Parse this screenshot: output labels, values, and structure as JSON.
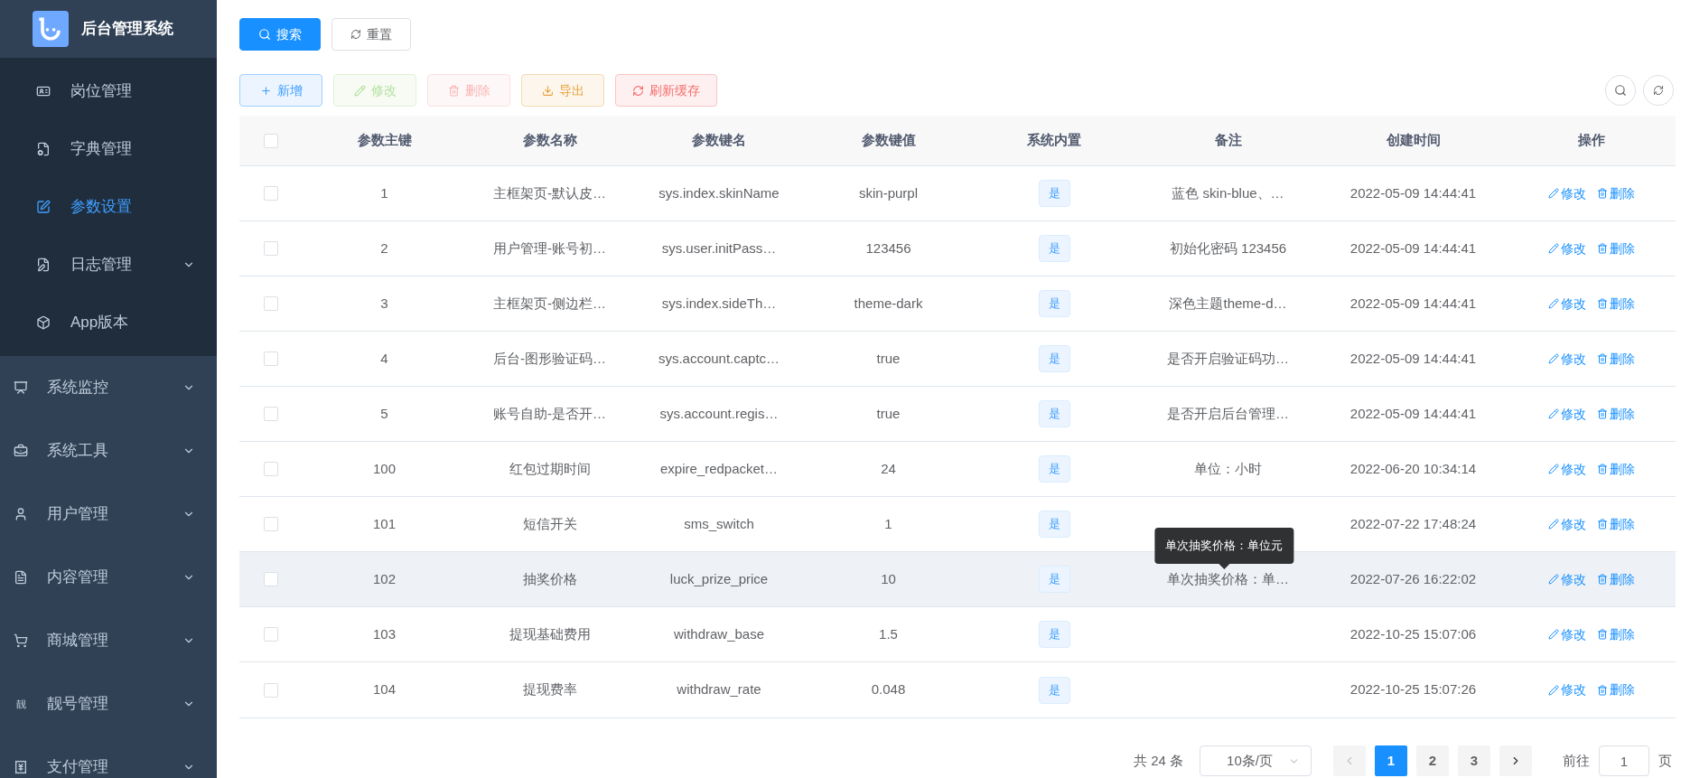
{
  "sidebar": {
    "title": "后台管理系统",
    "submenu_items": [
      {
        "label": "岗位管理",
        "kind": "link",
        "selected": false
      },
      {
        "label": "字典管理",
        "kind": "link",
        "selected": false
      },
      {
        "label": "参数设置",
        "kind": "link",
        "selected": true
      },
      {
        "label": "日志管理",
        "kind": "group",
        "selected": false
      },
      {
        "label": "App版本",
        "kind": "link",
        "selected": false
      }
    ],
    "items": [
      {
        "label": "系统监控"
      },
      {
        "label": "系统工具"
      },
      {
        "label": "用户管理"
      },
      {
        "label": "内容管理"
      },
      {
        "label": "商城管理"
      },
      {
        "label": "靓号管理",
        "icon_text": "靓"
      },
      {
        "label": "支付管理"
      }
    ]
  },
  "search_buttons": [
    {
      "label": "搜索",
      "kind": "primary"
    },
    {
      "label": "重置",
      "kind": "default"
    }
  ],
  "toolbar": [
    {
      "label": "新增",
      "kind": "add",
      "disabled": false
    },
    {
      "label": "修改",
      "kind": "edit",
      "disabled": true
    },
    {
      "label": "删除",
      "kind": "delete",
      "disabled": true
    },
    {
      "label": "导出",
      "kind": "export",
      "disabled": false
    },
    {
      "label": "刷新缓存",
      "kind": "refresh",
      "disabled": false
    }
  ],
  "table": {
    "columns": [
      "参数主键",
      "参数名称",
      "参数键名",
      "参数键值",
      "系统内置",
      "备注",
      "创建时间",
      "操作"
    ],
    "rows": [
      {
        "id": "1",
        "name": "主框架页-默认皮…",
        "key": "sys.index.skinName",
        "value": "skin-purpl",
        "builtin": "是",
        "remark": "蓝色 skin-blue、…",
        "created": "2022-05-09 14:44:41",
        "hovered": false,
        "checked": false,
        "actions": [
          "修改",
          "删除"
        ]
      },
      {
        "id": "2",
        "name": "用户管理-账号初…",
        "key": "sys.user.initPass…",
        "value": "123456",
        "builtin": "是",
        "remark": "初始化密码 123456",
        "created": "2022-05-09 14:44:41",
        "hovered": false,
        "checked": false,
        "actions": [
          "修改",
          "删除"
        ]
      },
      {
        "id": "3",
        "name": "主框架页-侧边栏…",
        "key": "sys.index.sideTh…",
        "value": "theme-dark",
        "builtin": "是",
        "remark": "深色主题theme-d…",
        "created": "2022-05-09 14:44:41",
        "hovered": false,
        "checked": false,
        "actions": [
          "修改",
          "删除"
        ]
      },
      {
        "id": "4",
        "name": "后台-图形验证码…",
        "key": "sys.account.captc…",
        "value": "true",
        "builtin": "是",
        "remark": "是否开启验证码功…",
        "created": "2022-05-09 14:44:41",
        "hovered": false,
        "checked": false,
        "actions": [
          "修改",
          "删除"
        ]
      },
      {
        "id": "5",
        "name": "账号自助-是否开…",
        "key": "sys.account.regis…",
        "value": "true",
        "builtin": "是",
        "remark": "是否开启后台管理…",
        "created": "2022-05-09 14:44:41",
        "hovered": false,
        "checked": false,
        "actions": [
          "修改",
          "删除"
        ]
      },
      {
        "id": "100",
        "name": "红包过期时间",
        "key": "expire_redpacket…",
        "value": "24",
        "builtin": "是",
        "remark": "单位：小时",
        "created": "2022-06-20 10:34:14",
        "hovered": false,
        "checked": false,
        "actions": [
          "修改",
          "删除"
        ]
      },
      {
        "id": "101",
        "name": "短信开关",
        "key": "sms_switch",
        "value": "1",
        "builtin": "是",
        "created": "2022-07-22 17:48:24",
        "hovered": false,
        "checked": false,
        "actions": [
          "修改",
          "删除"
        ]
      },
      {
        "id": "102",
        "name": "抽奖价格",
        "key": "luck_prize_price",
        "value": "10",
        "builtin": "是",
        "remark": "单次抽奖价格：单…",
        "tooltip": "单次抽奖价格：单位元",
        "created": "2022-07-26 16:22:02",
        "hovered": true,
        "checked": false,
        "actions": [
          "修改",
          "删除"
        ]
      },
      {
        "id": "103",
        "name": "提现基础费用",
        "key": "withdraw_base",
        "value": "1.5",
        "builtin": "是",
        "created": "2022-10-25 15:07:06",
        "hovered": false,
        "checked": false,
        "actions": [
          "修改",
          "删除"
        ]
      },
      {
        "id": "104",
        "name": "提现费率",
        "key": "withdraw_rate",
        "value": "0.048",
        "builtin": "是",
        "created": "2022-10-25 15:07:26",
        "hovered": false,
        "checked": false,
        "actions": [
          "修改",
          "删除"
        ]
      }
    ],
    "select_all_checked": false
  },
  "pagination": {
    "total": "共 24 条",
    "page_size": "10条/页",
    "prev_disabled": true,
    "pages": [
      {
        "label": "1",
        "selected": true
      },
      {
        "label": "2",
        "selected": false
      },
      {
        "label": "3",
        "selected": false
      }
    ],
    "goto_label": "前往",
    "goto_value": "1",
    "goto_suffix": "页"
  }
}
